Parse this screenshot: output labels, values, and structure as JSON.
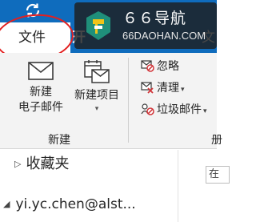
{
  "ribbon_tabs": {
    "file": "文件",
    "next_partial": "开",
    "right_partial": "文"
  },
  "watermark": {
    "name": "６６导航",
    "url": "66DAOHAN.COM"
  },
  "ribbon": {
    "new_mail": {
      "line1": "新建",
      "line2": "电子邮件"
    },
    "new_items": {
      "label": "新建项目",
      "caret": "▾"
    },
    "group_new": "新建",
    "ignore": "忽略",
    "clean_up": "清理",
    "junk": "垃圾邮件",
    "small_caret": "▾",
    "right_group_partial": "册"
  },
  "folder_pane": {
    "expand_glyph": "▷",
    "favorites": "收藏夹",
    "account_glyph": "◢",
    "account": "yi.yc.chen@alst...",
    "search_partial": "在"
  },
  "colors": {
    "accent": "#0f6cbd",
    "annotation_red": "#e32020",
    "ribbon_bg": "#f3f3f3"
  },
  "icons": {
    "quick_access": "sync-icon",
    "new_mail": "envelope-icon",
    "new_items": "calendar-envelope-icon",
    "ignore": "ignore-conversation-icon",
    "clean_up": "clean-up-icon",
    "junk": "junk-mail-icon",
    "watermark_logo": "66-navigation-logo"
  }
}
